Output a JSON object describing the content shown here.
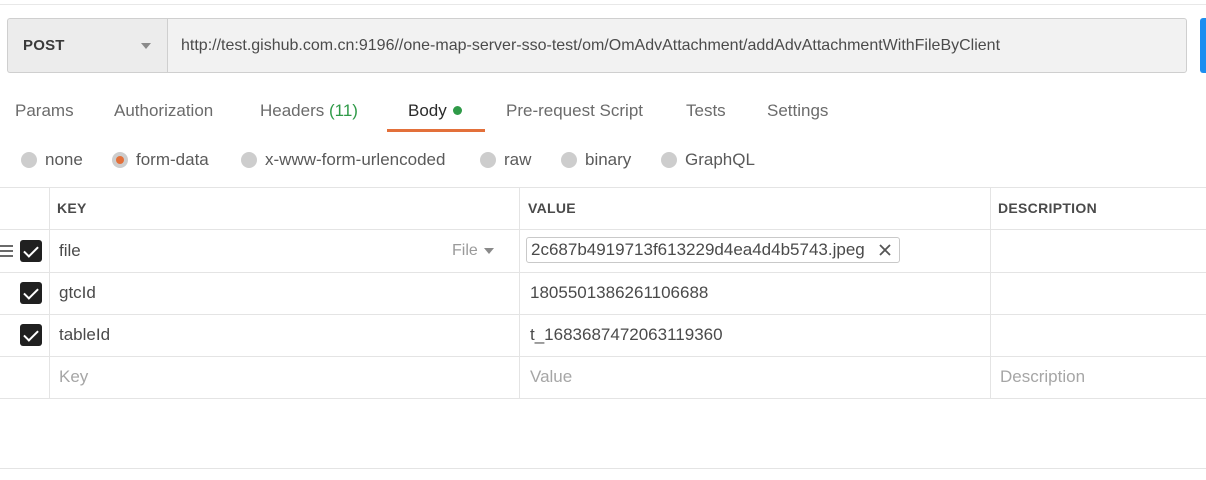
{
  "request": {
    "method": "POST",
    "url": "http://test.gishub.com.cn:9196//one-map-server-sso-test/om/OmAdvAttachment/addAdvAttachmentWithFileByClient"
  },
  "tabs": [
    {
      "label": "Params"
    },
    {
      "label": "Authorization"
    },
    {
      "label": "Headers",
      "count": "(11)"
    },
    {
      "label": "Body",
      "active": true
    },
    {
      "label": "Pre-request Script"
    },
    {
      "label": "Tests"
    },
    {
      "label": "Settings"
    }
  ],
  "body_types": [
    {
      "label": "none"
    },
    {
      "label": "form-data",
      "selected": true
    },
    {
      "label": "x-www-form-urlencoded"
    },
    {
      "label": "raw"
    },
    {
      "label": "binary"
    },
    {
      "label": "GraphQL"
    }
  ],
  "table": {
    "headers": {
      "key": "KEY",
      "value": "VALUE",
      "description": "DESCRIPTION"
    },
    "rows": [
      {
        "key": "file",
        "type": "File",
        "value": "2c687b4919713f613229d4ea4d4b5743.jpeg",
        "checked": true
      },
      {
        "key": "gtcId",
        "value": "1805501386261106688",
        "checked": true
      },
      {
        "key": "tableId",
        "value": "t_1683687472063119360",
        "checked": true
      }
    ],
    "placeholders": {
      "key": "Key",
      "value": "Value",
      "description": "Description"
    }
  },
  "colors": {
    "accent": "#e3703a",
    "success": "#2f9a48",
    "send": "#1c8ef0"
  }
}
